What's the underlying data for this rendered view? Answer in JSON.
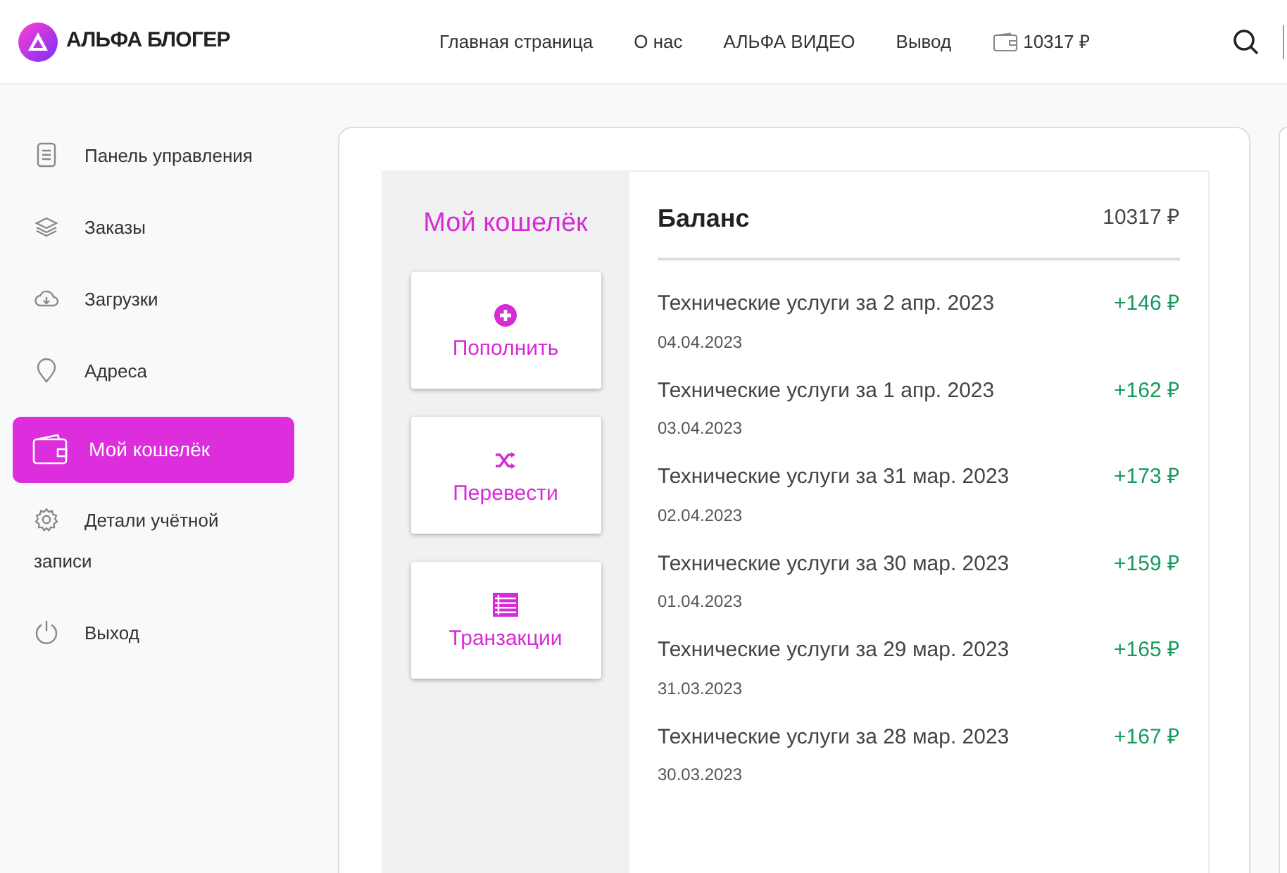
{
  "header": {
    "logo": "АЛЬФА БЛОГЕР",
    "nav": [
      {
        "label": "Главная страница"
      },
      {
        "label": "О нас"
      },
      {
        "label": "АЛЬФА ВИДЕО"
      },
      {
        "label": "Вывод"
      }
    ],
    "balance": "10317 ₽"
  },
  "sidebar": {
    "items": [
      {
        "label": "Панель управления",
        "selected": false
      },
      {
        "label": "Заказы",
        "selected": false
      },
      {
        "label": "Загрузки",
        "selected": false
      },
      {
        "label": "Адреса",
        "selected": false
      },
      {
        "label": "Мой кошелёк",
        "selected": true
      },
      {
        "label": "Детали учётной записи",
        "selected": false
      },
      {
        "label": "Выход",
        "selected": false
      }
    ]
  },
  "wallet": {
    "title": "Мой кошелёк",
    "actions": [
      {
        "label": "Пополнить"
      },
      {
        "label": "Перевести"
      },
      {
        "label": "Транзакции"
      }
    ]
  },
  "balance": {
    "title": "Баланс",
    "amount": "10317 ₽",
    "transactions": [
      {
        "title": "Технические услуги за 2 апр. 2023",
        "date": "04.04.2023",
        "amount": "+146 ₽"
      },
      {
        "title": "Технические услуги за 1 апр. 2023",
        "date": "03.04.2023",
        "amount": "+162 ₽"
      },
      {
        "title": "Технические услуги за 31 мар. 2023",
        "date": "02.04.2023",
        "amount": "+173 ₽"
      },
      {
        "title": "Технические услуги за 30 мар. 2023",
        "date": "01.04.2023",
        "amount": "+159 ₽"
      },
      {
        "title": "Технические услуги за 29 мар. 2023",
        "date": "31.03.2023",
        "amount": "+165 ₽"
      },
      {
        "title": "Технические услуги за 28 мар. 2023",
        "date": "30.03.2023",
        "amount": "+167 ₽"
      }
    ]
  }
}
